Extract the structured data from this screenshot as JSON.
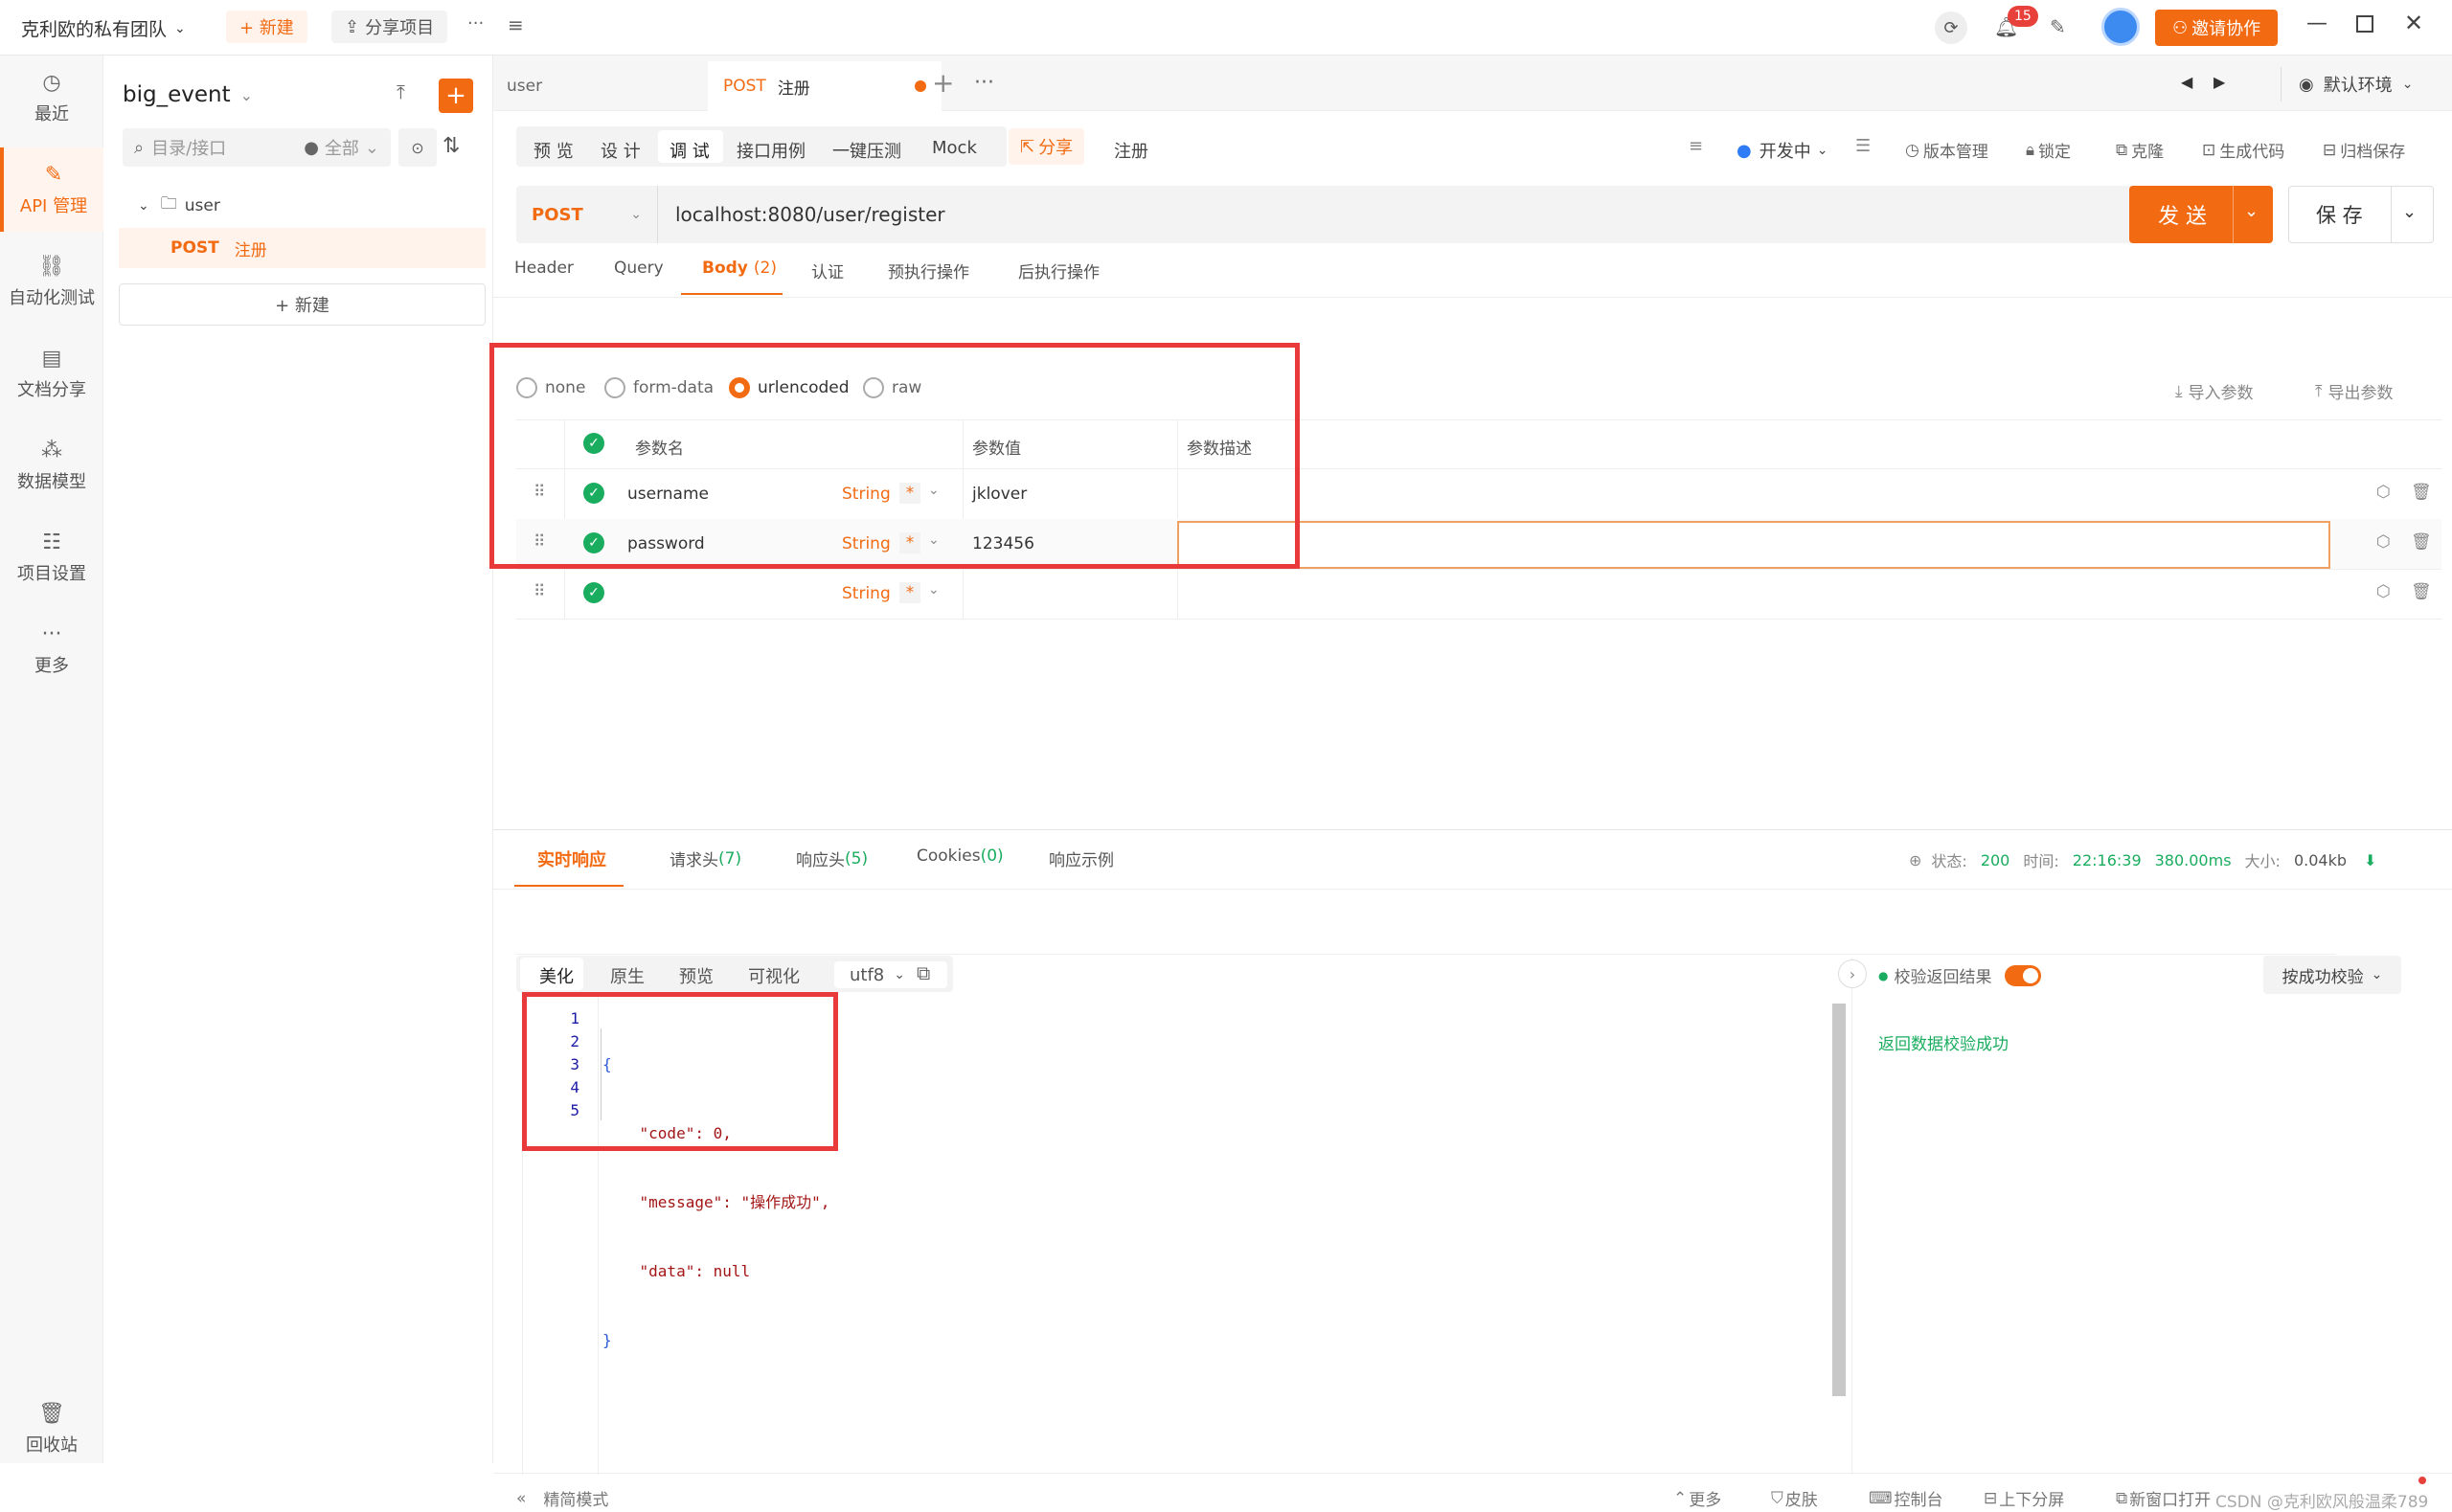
{
  "topbar": {
    "team": "克利欧的私有团队",
    "new_label": "+ 新建",
    "share_label": "分享项目",
    "more": "···",
    "notif_count": "15",
    "invite_label": "邀请协作"
  },
  "nav": {
    "items": [
      {
        "label": "最近",
        "icon": "clock-icon"
      },
      {
        "label": "API 管理",
        "icon": "api-icon"
      },
      {
        "label": "自动化测试",
        "icon": "automation-icon"
      },
      {
        "label": "文档分享",
        "icon": "doc-icon"
      },
      {
        "label": "数据模型",
        "icon": "model-icon"
      },
      {
        "label": "项目设置",
        "icon": "settings-icon"
      },
      {
        "label": "更多",
        "icon": "more-icon"
      }
    ],
    "trash": "回收站"
  },
  "tree": {
    "project": "big_event",
    "search_placeholder": "目录/接口",
    "filter": "全部",
    "folder": "user",
    "method": "POST",
    "api_name": "注册",
    "new_label": "+ 新建"
  },
  "tabs": {
    "tab1": "user",
    "tab2_method": "POST",
    "tab2_name": "注册",
    "env": "默认环境"
  },
  "subtabs": {
    "items": [
      "预 览",
      "设 计",
      "调 试",
      "接口用例",
      "一键压测",
      "Mock"
    ],
    "share": "分享",
    "name": "注册",
    "status": "开发中",
    "version": "版本管理",
    "lock": "锁定",
    "clone": "克隆",
    "gen": "生成代码",
    "archive": "归档保存"
  },
  "request": {
    "method": "POST",
    "url": "localhost:8080/user/register",
    "send": "发 送",
    "save": "保 存"
  },
  "reqtabs": {
    "header": "Header",
    "query": "Query",
    "body": "Body",
    "body_count": "(2)",
    "auth": "认证",
    "pre": "预执行操作",
    "post": "后执行操作"
  },
  "bodytype": {
    "none": "none",
    "form": "form-data",
    "urlenc": "urlencoded",
    "raw": "raw",
    "import": "导入参数",
    "export": "导出参数"
  },
  "params": {
    "h_name": "参数名",
    "h_value": "参数值",
    "h_desc": "参数描述",
    "rows": [
      {
        "name": "username",
        "type": "String",
        "value": "jklover"
      },
      {
        "name": "password",
        "type": "String",
        "value": "123456"
      },
      {
        "name": "",
        "type": "String",
        "value": ""
      }
    ],
    "required": "*"
  },
  "response": {
    "tabs": {
      "live": "实时响应",
      "req_headers": "请求头",
      "req_headers_count": "(7)",
      "resp_headers": "响应头",
      "resp_headers_count": "(5)",
      "cookies": "Cookies",
      "cookies_count": "(0)",
      "example": "响应示例"
    },
    "status_label": "状态:",
    "status": "200",
    "time_label": "时间:",
    "time": "22:16:39",
    "duration": "380.00ms",
    "size_label": "大小:",
    "size": "0.04kb",
    "views": [
      "美化",
      "原生",
      "预览",
      "可视化"
    ],
    "encoding": "utf8",
    "code_lines": [
      {
        "n": "1",
        "t": "{"
      },
      {
        "n": "2",
        "t": "    \"code\": 0,"
      },
      {
        "n": "3",
        "t": "    \"message\": \"操作成功\","
      },
      {
        "n": "4",
        "t": "    \"data\": null"
      },
      {
        "n": "5",
        "t": "}"
      }
    ],
    "validate_label": "校验返回结果",
    "validate_mode": "按成功校验",
    "validate_result": "返回数据校验成功"
  },
  "footer": {
    "simple": "精简模式",
    "more": "更多",
    "skin": "皮肤",
    "console": "控制台",
    "split": "上下分屏",
    "newwin": "新窗口打开",
    "watermark": "CSDN @克利欧风般温柔789"
  },
  "colors": {
    "accent": "#f26b13",
    "success": "#1aad5f",
    "highlight": "#e83a3a"
  }
}
